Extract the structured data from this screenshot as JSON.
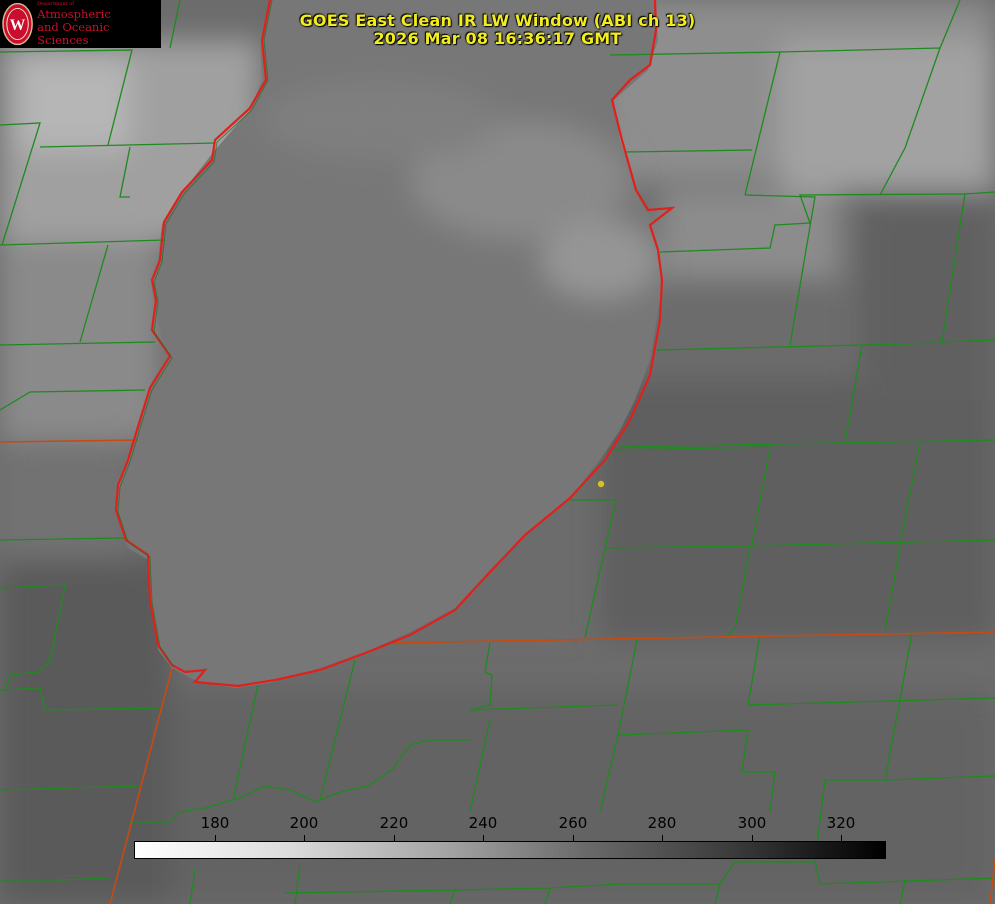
{
  "title": {
    "line1": "GOES East Clean IR LW Window (ABI ch 13)",
    "line2": "2026 Mar 08 16:36:17 GMT"
  },
  "logo": {
    "small_text": "Department of",
    "line1": "Atmospheric",
    "line2": "and Oceanic Sciences",
    "seal_letter": "W"
  },
  "colorbar": {
    "min": 163,
    "max": 330,
    "ticks": [
      "180",
      "200",
      "220",
      "240",
      "260",
      "280",
      "300",
      "320"
    ],
    "tick_values": [
      180,
      200,
      220,
      240,
      260,
      280,
      300,
      320
    ],
    "colormap": "white-to-black grayscale"
  },
  "colors": {
    "title_text": "#f2ec20",
    "county_lines": "#1f8a1f",
    "coastline": "#e0201a",
    "state_lines": "#c84a10",
    "location_marker": "#d6c21c",
    "logo_text": "#c8102e"
  }
}
